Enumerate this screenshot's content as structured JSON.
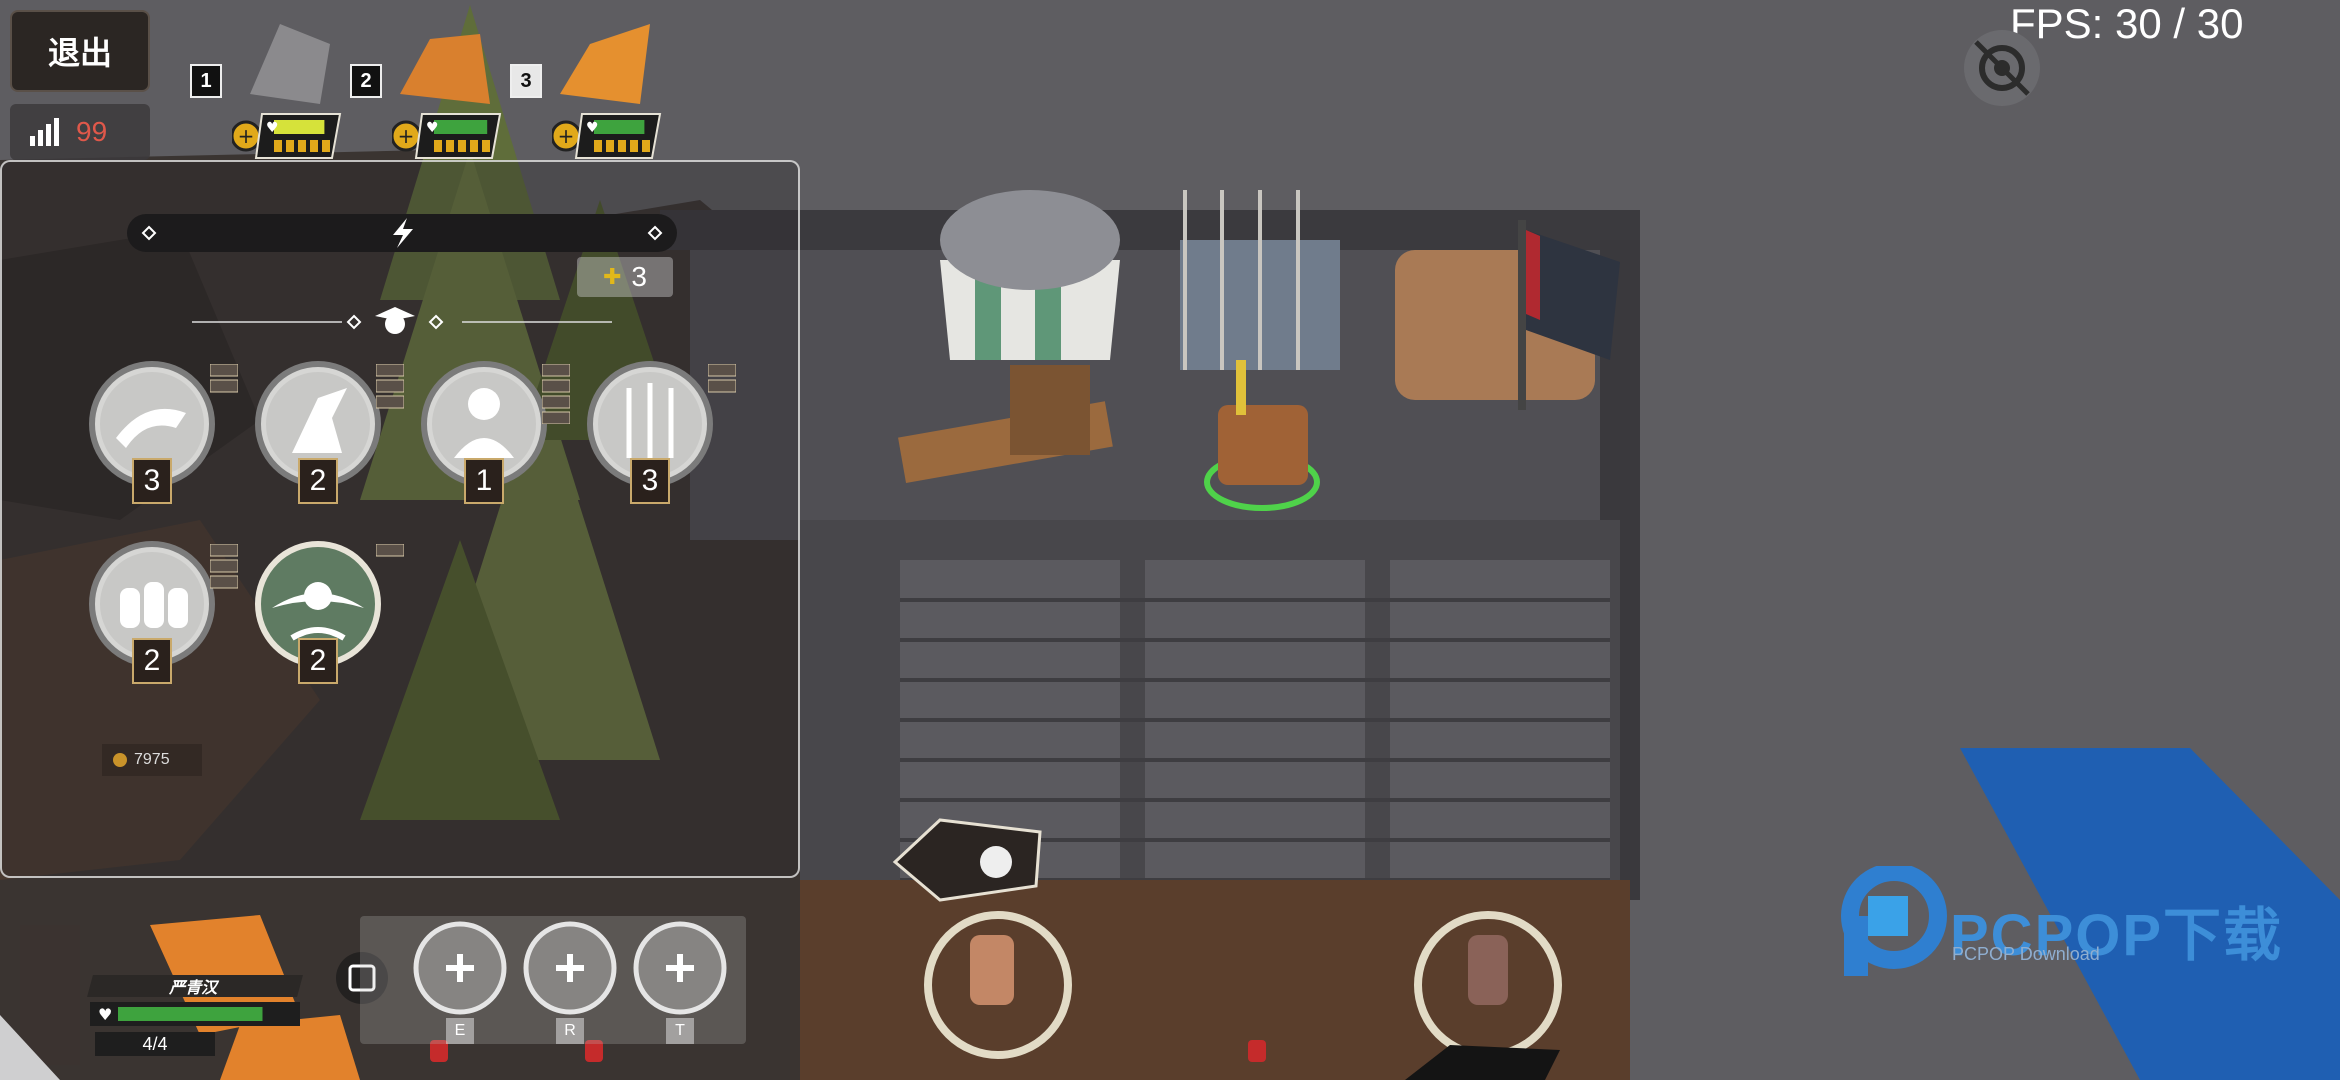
{
  "exit_label": "退出",
  "signal_value": "99",
  "fps_text": "FPS: 30 / 30",
  "heroes": [
    {
      "slot": "1",
      "health_fraction": 0.9
    },
    {
      "slot": "2",
      "health_fraction": 0.95
    },
    {
      "slot": "3",
      "health_fraction": 0.9
    }
  ],
  "panel": {
    "gold_cost": "3",
    "skills": [
      {
        "icon": "archer-sweep-icon",
        "count": "3"
      },
      {
        "icon": "swordsman-icon",
        "count": "2"
      },
      {
        "icon": "spearman-icon",
        "count": "1"
      },
      {
        "icon": "spear-squad-icon",
        "count": "3"
      },
      {
        "icon": "shield-squad-icon",
        "count": "2"
      },
      {
        "icon": "whirlwind-icon",
        "count": "2"
      }
    ],
    "coins": "7975"
  },
  "player": {
    "name": "严青汉",
    "health_fraction": 0.85,
    "ammo": "4/4"
  },
  "abilities": [
    {
      "key": "E"
    },
    {
      "key": "R"
    },
    {
      "key": "T"
    }
  ],
  "watermark": {
    "main": "PCPOP下载",
    "sub": "PCPOP Download"
  },
  "colors": {
    "health_green": "#3ea33e",
    "health_yellow": "#d6e23a",
    "accent_gold": "#c9a96b",
    "watermark_blue": "#1f5fb2"
  }
}
